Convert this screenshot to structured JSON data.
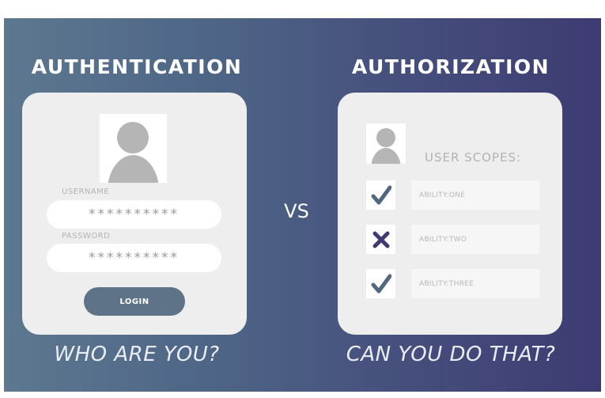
{
  "authentication": {
    "heading": "AUTHENTICATION",
    "username_label": "USERNAME",
    "username_value": "**********",
    "password_label": "PASSWORD",
    "password_value": "**********",
    "login_label": "LOGIN",
    "tagline": "WHO ARE YOU?"
  },
  "vs_label": "VS",
  "authorization": {
    "heading": "AUTHORIZATION",
    "scopes_title": "USER SCOPES:",
    "scopes": [
      {
        "label": "ABILITY:ONE",
        "status": "check-icon"
      },
      {
        "label": "ABILITY:TWO",
        "status": "cross-icon"
      },
      {
        "label": "ABILITY:THREE",
        "status": "check-icon"
      }
    ],
    "tagline": "CAN YOU DO THAT?"
  },
  "colors": {
    "check": "#50687f",
    "cross": "#3d3b72",
    "login_button": "#5e7388"
  }
}
